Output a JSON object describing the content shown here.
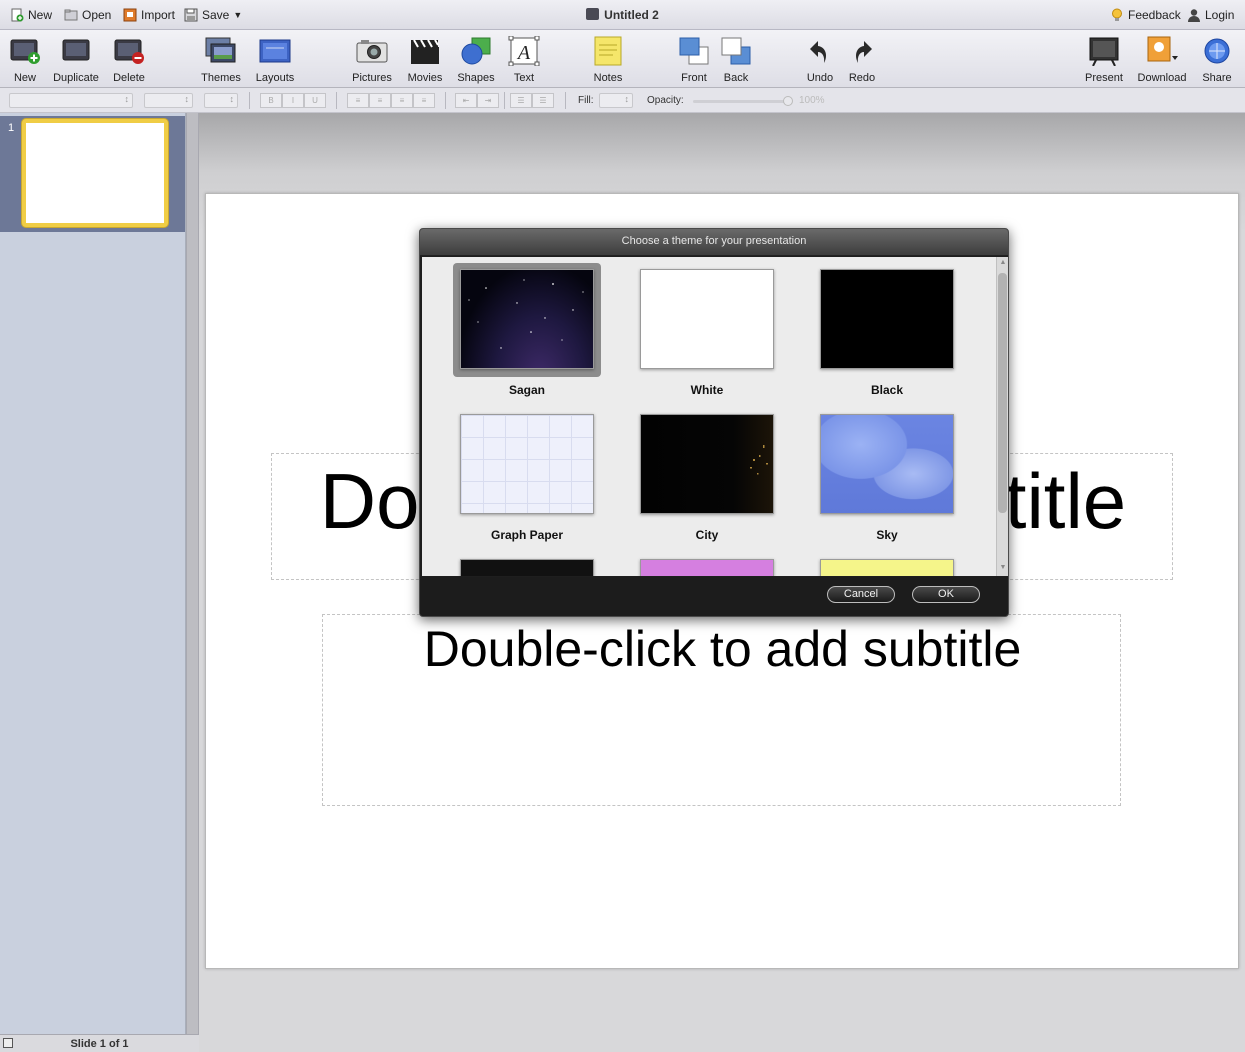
{
  "menubar": {
    "new_label": "New",
    "open_label": "Open",
    "import_label": "Import",
    "save_label": "Save",
    "document_title": "Untitled 2",
    "feedback_label": "Feedback",
    "login_label": "Login"
  },
  "toolbar": {
    "new": "New",
    "duplicate": "Duplicate",
    "delete": "Delete",
    "themes": "Themes",
    "layouts": "Layouts",
    "pictures": "Pictures",
    "movies": "Movies",
    "shapes": "Shapes",
    "text": "Text",
    "notes": "Notes",
    "front": "Front",
    "back": "Back",
    "undo": "Undo",
    "redo": "Redo",
    "present": "Present",
    "download": "Download",
    "share": "Share"
  },
  "format_bar": {
    "bold": "B",
    "italic": "I",
    "underline": "U",
    "fill_label": "Fill:",
    "opacity_label": "Opacity:",
    "opacity_value": "100%",
    "opacity_fraction": 1.0
  },
  "slides_panel": {
    "slide_number": "1",
    "status_text": "Slide 1 of 1"
  },
  "slide": {
    "title_placeholder": "Double-click to add title",
    "subtitle_placeholder": "Double-click to add subtitle"
  },
  "theme_dialog": {
    "title": "Choose a theme for your presentation",
    "themes": [
      {
        "name": "Sagan",
        "selected": true
      },
      {
        "name": "White",
        "selected": false
      },
      {
        "name": "Black",
        "selected": false
      },
      {
        "name": "Graph Paper",
        "selected": false
      },
      {
        "name": "City",
        "selected": false
      },
      {
        "name": "Sky",
        "selected": false
      }
    ],
    "cancel_label": "Cancel",
    "ok_label": "OK"
  },
  "colors": {
    "thumbnail_border": "#f0cd45",
    "panel_selected": "#6d7897",
    "dialog_dark": "#1e1e1e"
  }
}
